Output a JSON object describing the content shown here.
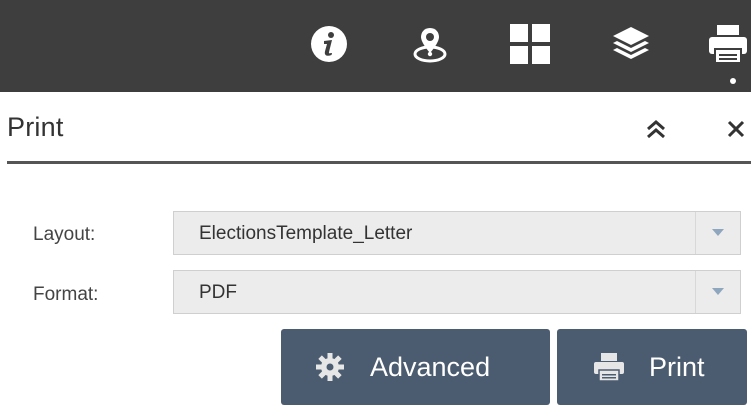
{
  "toolbar": {
    "icons": [
      {
        "name": "info-icon"
      },
      {
        "name": "locate-icon"
      },
      {
        "name": "basemap-gallery-icon"
      },
      {
        "name": "layers-icon"
      },
      {
        "name": "print-icon"
      }
    ],
    "colors": {
      "background": "#3e3e3e",
      "icon": "#ffffff"
    }
  },
  "panel": {
    "title": "Print"
  },
  "form": {
    "layout_label": "Layout:",
    "layout_value": "ElectionsTemplate_Letter",
    "format_label": "Format:",
    "format_value": "PDF"
  },
  "buttons": {
    "advanced_label": "Advanced",
    "print_label": "Print",
    "color": "#4c5c70"
  }
}
